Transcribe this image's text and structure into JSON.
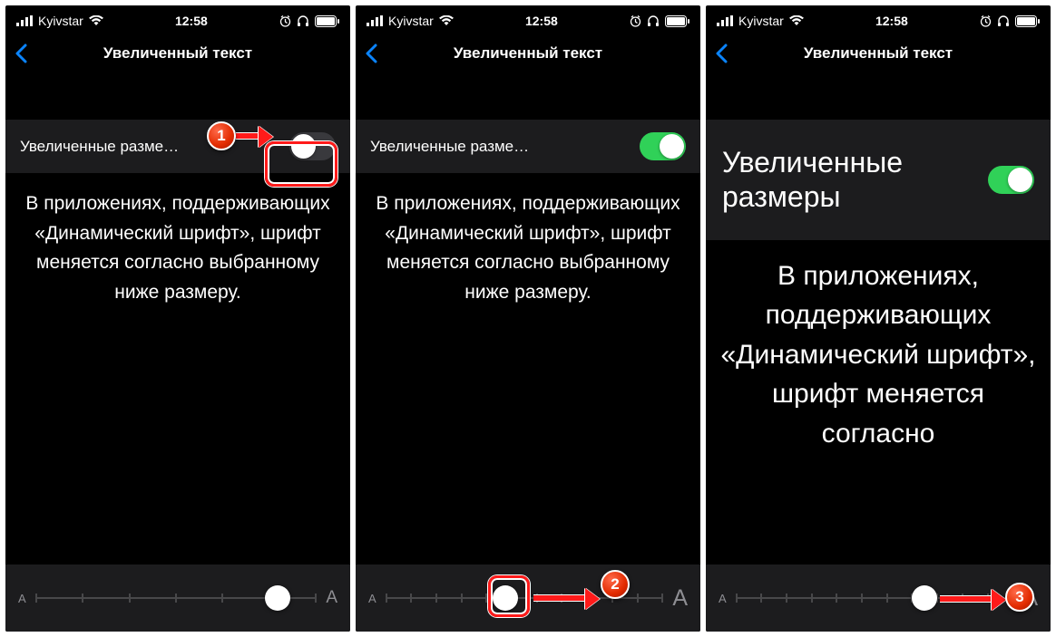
{
  "status": {
    "carrier": "Kyivstar",
    "time": "12:58"
  },
  "nav": {
    "title": "Увеличенный текст"
  },
  "toggle": {
    "label_truncated": "Увеличенные разме…",
    "label_full": "Увеличенные размеры"
  },
  "description": "В приложениях, поддерживающих «Динамический шрифт», шрифт меняется согласно выбранному ниже размеру.",
  "description_large": "В приложениях, поддерживаю­щих «Динамиче­ский шрифт», шрифт меняется согласно",
  "slider": {
    "small_label": "A",
    "large_label": "A",
    "panels": [
      {
        "ticks": 7,
        "pos_pct": 86,
        "large_fs": 19
      },
      {
        "ticks": 12,
        "pos_pct": 43,
        "large_fs": 25
      },
      {
        "ticks": 12,
        "pos_pct": 68,
        "large_fs": 25
      }
    ]
  },
  "markers": {
    "m1": "1",
    "m2": "2",
    "m3": "3"
  },
  "colors": {
    "accent_blue": "#0a84ff",
    "switch_green": "#30d158",
    "cell_bg": "#1c1c1e",
    "marker_red": "#e22b00"
  }
}
